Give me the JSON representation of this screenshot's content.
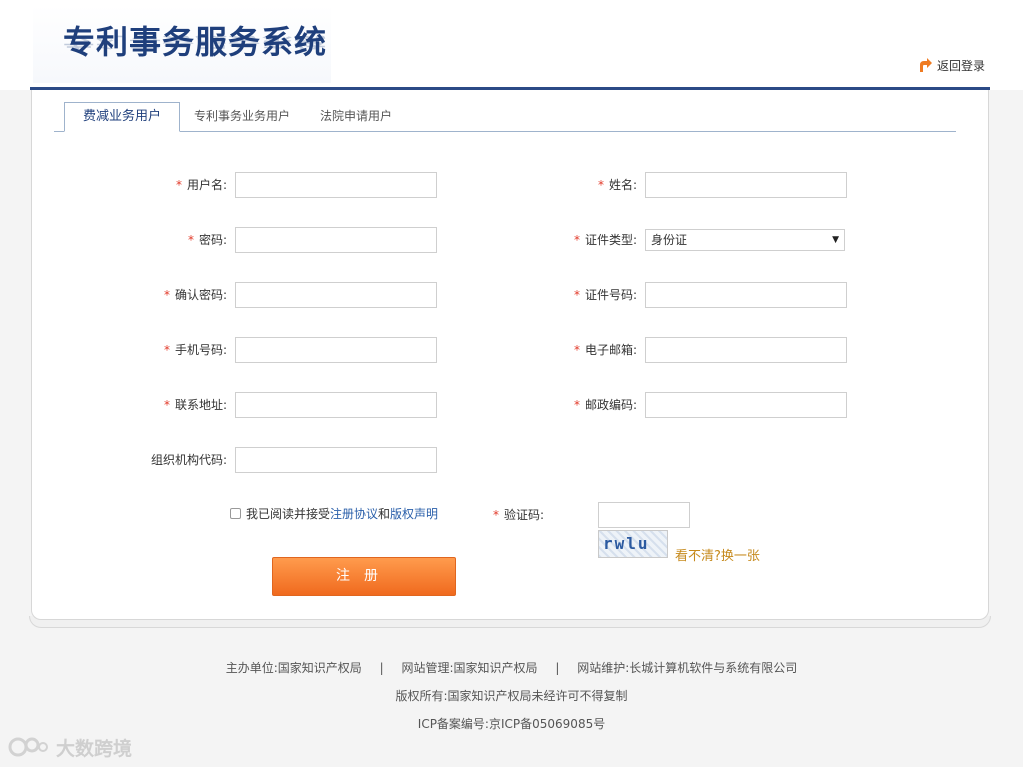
{
  "header": {
    "logo_text": "专利事务服务系统",
    "back_login_label": "返回登录"
  },
  "tabs": [
    {
      "label": "费减业务用户",
      "active": true
    },
    {
      "label": "专利事务业务用户",
      "active": false
    },
    {
      "label": "法院申请用户",
      "active": false
    }
  ],
  "form": {
    "required_mark": "*",
    "username": {
      "label": "用户名:",
      "value": ""
    },
    "fullname": {
      "label": "姓名:",
      "value": ""
    },
    "password": {
      "label": "密码:",
      "value": ""
    },
    "id_type": {
      "label": "证件类型:",
      "selected": "身份证"
    },
    "confirm_password": {
      "label": "确认密码:",
      "value": ""
    },
    "id_number": {
      "label": "证件号码:",
      "value": ""
    },
    "phone": {
      "label": "手机号码:",
      "value": ""
    },
    "email": {
      "label": "电子邮箱:",
      "value": ""
    },
    "address": {
      "label": "联系地址:",
      "value": ""
    },
    "postcode": {
      "label": "邮政编码:",
      "value": ""
    },
    "org_code": {
      "label": "组织机构代码:",
      "value": ""
    },
    "agreement": {
      "checked": false,
      "prefix": "我已阅读并接受",
      "link1": "注册协议",
      "middle": "和",
      "link2": "版权声明"
    },
    "captcha": {
      "label": "验证码:",
      "value": "",
      "image_text": "rwlu",
      "refresh_label": "看不清?换一张"
    },
    "submit_label": "注册"
  },
  "footer": {
    "sponsor": "主办单位:国家知识产权局",
    "manager": "网站管理:国家知识产权局",
    "maintainer": "网站维护:长城计算机软件与系统有限公司",
    "separator": "|",
    "copyright": "版权所有:国家知识产权局未经许可不得复制",
    "icp": "ICP备案编号:京ICP备05069085号"
  },
  "watermark": "大数跨境",
  "colors": {
    "brand_blue": "#2b4a86",
    "submit_orange": "#f47a2a",
    "required_red": "#e23a2a",
    "link_blue": "#2a5faa",
    "refresh_gold": "#c68a1d"
  },
  "icons": {
    "back": "back-arrow-icon",
    "select": "chevron-down-icon",
    "watermark": "watermark-logo-icon"
  }
}
